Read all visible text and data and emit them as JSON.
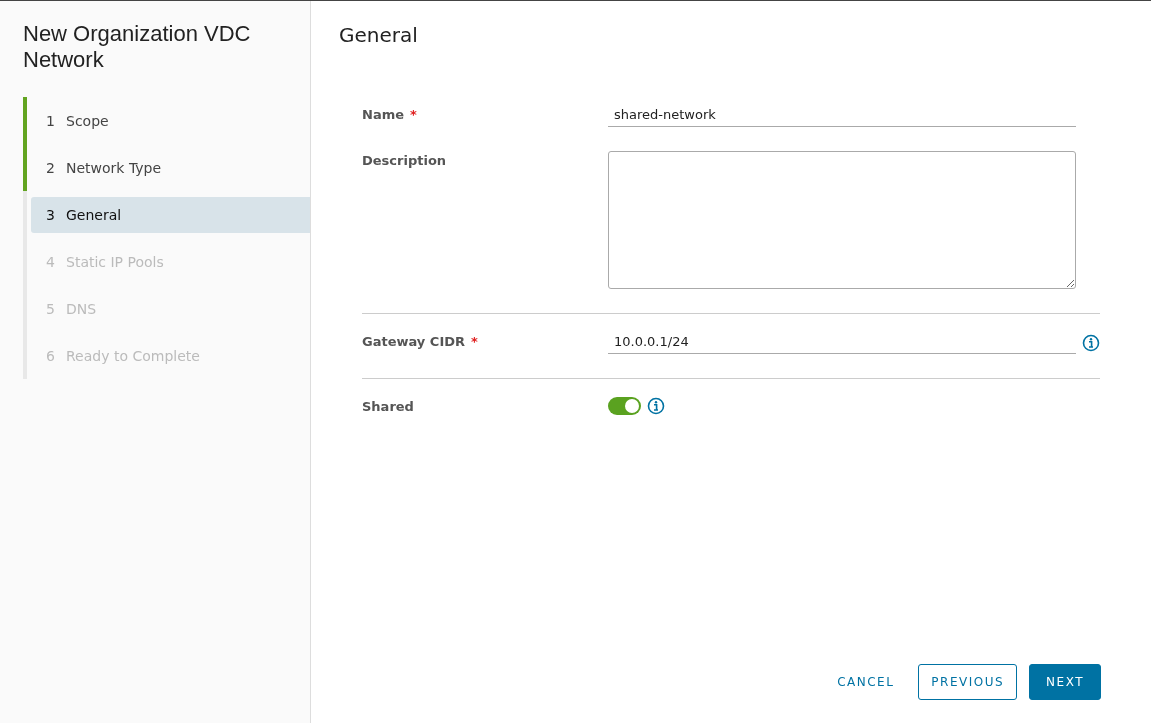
{
  "wizard": {
    "title": "New Organization VDC Network"
  },
  "steps": [
    {
      "number": "1",
      "label": "Scope",
      "completed": true,
      "selected": false,
      "disabled": false
    },
    {
      "number": "2",
      "label": "Network Type",
      "completed": true,
      "selected": false,
      "disabled": false
    },
    {
      "number": "3",
      "label": "General",
      "completed": false,
      "selected": true,
      "disabled": false
    },
    {
      "number": "4",
      "label": "Static IP Pools",
      "completed": false,
      "selected": false,
      "disabled": true
    },
    {
      "number": "5",
      "label": "DNS",
      "completed": false,
      "selected": false,
      "disabled": true
    },
    {
      "number": "6",
      "label": "Ready to Complete",
      "completed": false,
      "selected": false,
      "disabled": true
    }
  ],
  "page": {
    "title": "General"
  },
  "form": {
    "sections": [
      [
        {
          "kind": "text",
          "label": "Name",
          "required_mark": "*",
          "value": "shared-network",
          "info": false
        },
        {
          "kind": "textarea",
          "label": "Description",
          "info": false
        }
      ],
      [
        {
          "kind": "text",
          "label": "Gateway CIDR",
          "required_mark": "*",
          "value": "10.0.0.1/24",
          "info": true
        }
      ],
      [
        {
          "kind": "toggle",
          "label": "Shared",
          "on": true,
          "info": true
        }
      ]
    ]
  },
  "buttons": [
    {
      "kind": "link",
      "label": "CANCEL"
    },
    {
      "kind": "outline",
      "label": "PREVIOUS"
    },
    {
      "kind": "primary",
      "label": "NEXT"
    }
  ]
}
